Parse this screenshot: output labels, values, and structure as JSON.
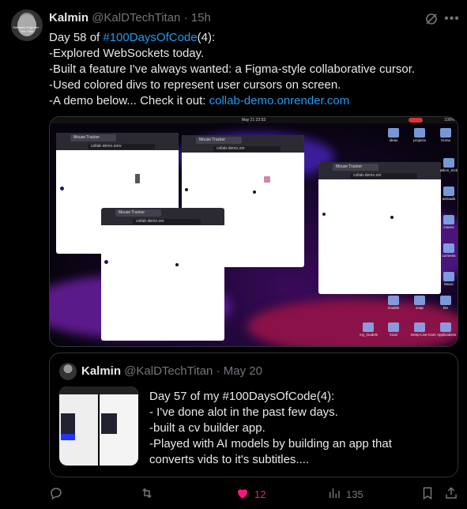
{
  "author": {
    "name": "Kalmin",
    "handle": "@KalDTechTitan",
    "separator": "·",
    "time": "15h",
    "avatar_text": "Software Engineer · The Titan"
  },
  "tweet": {
    "line1_prefix": "Day 58 of ",
    "hashtag": "#100DaysOfCode",
    "line1_suffix": "(4):",
    "line2": "-Explored WebSockets today.",
    "line3": "-Built a feature I've always wanted: a Figma-style collaborative cursor.",
    "line4": "-Used colored divs to represent user cursors on screen.",
    "line5_prefix": "-A demo below... Check it out: ",
    "link": "collab-demo.onrender.com"
  },
  "media": {
    "clock": "May 21  23:53",
    "system_tray": "100%",
    "windows": [
      {
        "tab": "Mouse Tracker",
        "url": "collab-demo.onre"
      },
      {
        "tab": "Mouse Tracker",
        "url": "collab-demo.onr"
      },
      {
        "tab": "Mouse Tracker",
        "url": "collab-demo.onr"
      },
      {
        "tab": "Mouse Tracker",
        "url": "collab-demo.onr"
      }
    ],
    "desktop_icons": [
      "ideas",
      "projects",
      "Home",
      "athon_tricks",
      "wnloads",
      "ictures",
      "cuments",
      "Music",
      "models",
      "snap",
      "bin",
      "my_models",
      "local",
      "Deep-Live-Cam",
      "Applications"
    ]
  },
  "quote": {
    "name": "Kalmin",
    "handle": "@KalDTechTitan",
    "separator": "·",
    "time": "May 20",
    "text_line1": "Day 57 of my #100DaysOfCode(4):",
    "text_line2": "- I've done alot in the past few days.",
    "text_line3": "-built a cv builder app.",
    "text_line4": "-Played with AI models by building an app that",
    "text_line5": "converts vids to it's subtitles...."
  },
  "actions": {
    "reply_icon": "reply-icon",
    "retweet_icon": "retweet-icon",
    "like_icon": "heart-icon",
    "likes": "12",
    "views_icon": "views-icon",
    "views": "135",
    "bookmark_icon": "bookmark-icon",
    "share_icon": "share-icon"
  },
  "colors": {
    "link": "#1d9bf0",
    "like": "#f91880",
    "muted": "#71767b",
    "border": "#2f3336"
  }
}
